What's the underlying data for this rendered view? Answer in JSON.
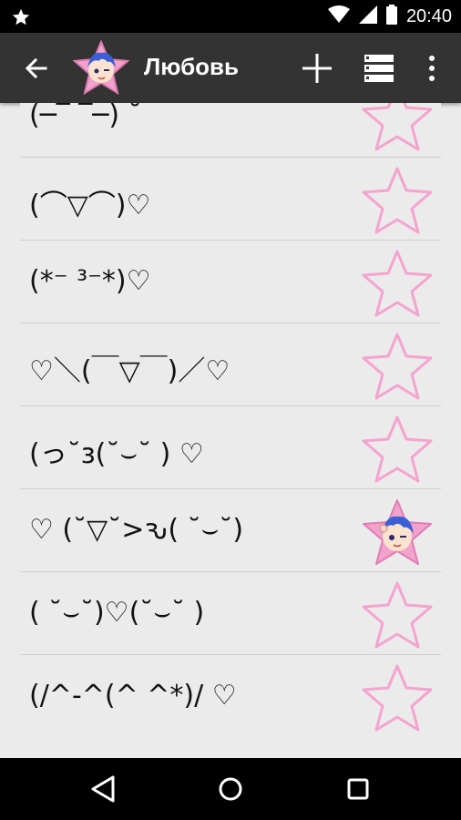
{
  "status_bar": {
    "time": "20:40",
    "icons": [
      "notification-star-icon",
      "wifi-icon",
      "signal-icon",
      "battery-icon"
    ]
  },
  "app_bar": {
    "title": "Любовь",
    "actions": [
      "add-icon",
      "list-view-icon",
      "more-vert-icon"
    ]
  },
  "items": [
    {
      "text": "(─‾ ‾─) ˘",
      "favorite": false,
      "partial": true
    },
    {
      "text": "(⌒▽⌒)♡",
      "favorite": false
    },
    {
      "text": "(*⁻ ³⁻*)♡",
      "favorite": false
    },
    {
      "text": "♡＼(￣▽￣)／♡",
      "favorite": false
    },
    {
      "text": "(っ˘з(˘⌣˘ ) ♡",
      "favorite": false
    },
    {
      "text": "♡ (˘▽˘>ԅ( ˘⌣˘)",
      "favorite": true
    },
    {
      "text": "( ˘⌣˘)♡(˘⌣˘ )",
      "favorite": false
    },
    {
      "text": "(/^-^(^ ^*)/ ♡",
      "favorite": false
    }
  ],
  "colors": {
    "star_outline": "#f5a3cf",
    "app_bar": "#333333",
    "background": "#ebebeb"
  },
  "nav_bar": [
    "back-triangle-icon",
    "home-circle-icon",
    "recents-square-icon"
  ]
}
